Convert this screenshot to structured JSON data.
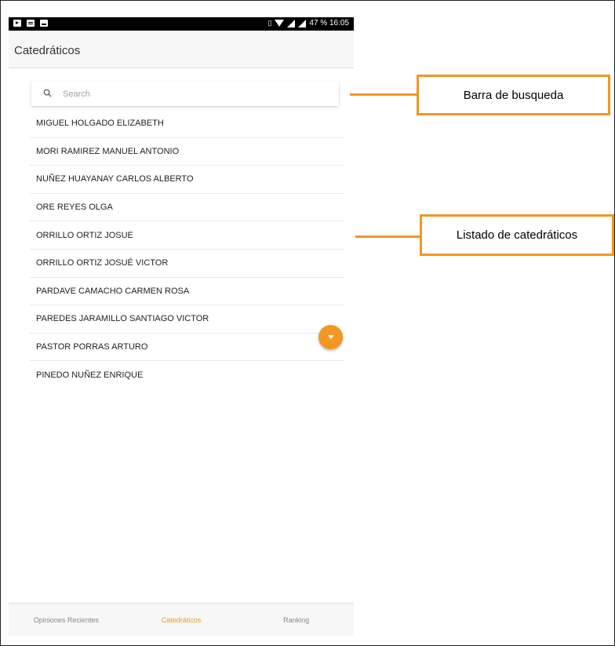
{
  "statusbar": {
    "battery_time": "47 % 16:05"
  },
  "appbar": {
    "title": "Catedráticos"
  },
  "search": {
    "placeholder": "Search",
    "value": ""
  },
  "professors": [
    "MIGUEL HOLGADO ELIZABETH",
    "MORI RAMIREZ MANUEL ANTONIO",
    "NUÑEZ HUAYANAY CARLOS ALBERTO",
    "ORE REYES OLGA",
    "ORRILLO ORTIZ JOSUE",
    "ORRILLO ORTIZ JOSUÉ VICTOR",
    "PARDAVE CAMACHO CARMEN ROSA",
    "PAREDES JARAMILLO SANTIAGO VICTOR",
    "PASTOR PORRAS ARTURO",
    "PINEDO NUÑEZ ENRIQUE"
  ],
  "bottom_nav": {
    "items": [
      "Opiniones Recientes",
      "Catedráticos",
      "Ranking"
    ],
    "active": "Catedráticos"
  },
  "annotations": {
    "search_label": "Barra de busqueda",
    "list_label": "Listado de catedráticos"
  },
  "colors": {
    "accent": "#f39623",
    "statusbar": "#000000",
    "appbar": "#f7f7f7"
  },
  "icons": {
    "search": "search-icon",
    "fab": "chevron-down-icon"
  }
}
